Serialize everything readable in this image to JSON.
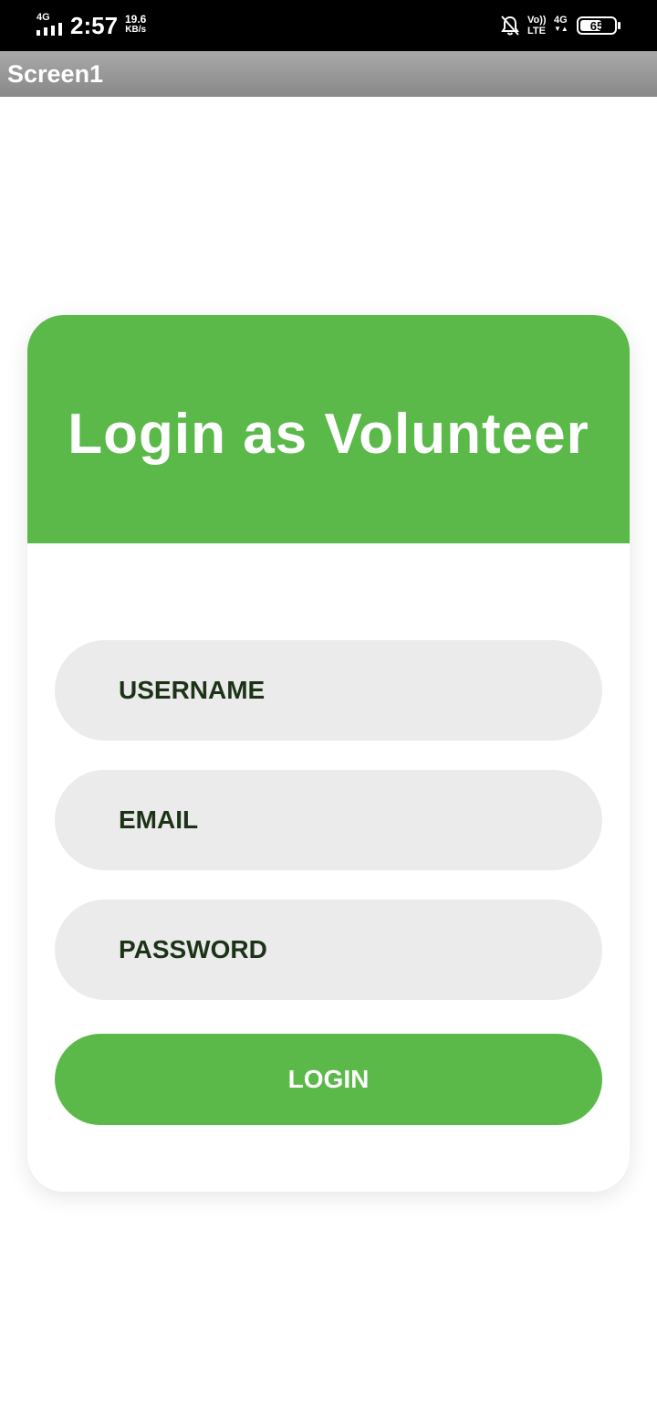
{
  "status_bar": {
    "network_small": "4G",
    "time": "2:57",
    "speed_value": "19.6",
    "speed_unit": "KB/s",
    "volte_top": "Vo))",
    "volte_bottom": "LTE",
    "network_right": "4G",
    "battery": "65",
    "battery_level": 0.65,
    "icons": [
      "signal-icon",
      "bell-off-icon",
      "battery-icon"
    ]
  },
  "title_bar": {
    "title": "Screen1"
  },
  "card": {
    "title": "Login as Volunteer",
    "fields": {
      "username_placeholder": "USERNAME",
      "email_placeholder": "EMAIL",
      "password_placeholder": "PASSWORD"
    },
    "login_label": "LOGIN"
  },
  "colors": {
    "accent_green": "#5ab948",
    "field_bg": "#ebebeb",
    "field_text": "#1c3317",
    "title_bar": "#999999"
  }
}
